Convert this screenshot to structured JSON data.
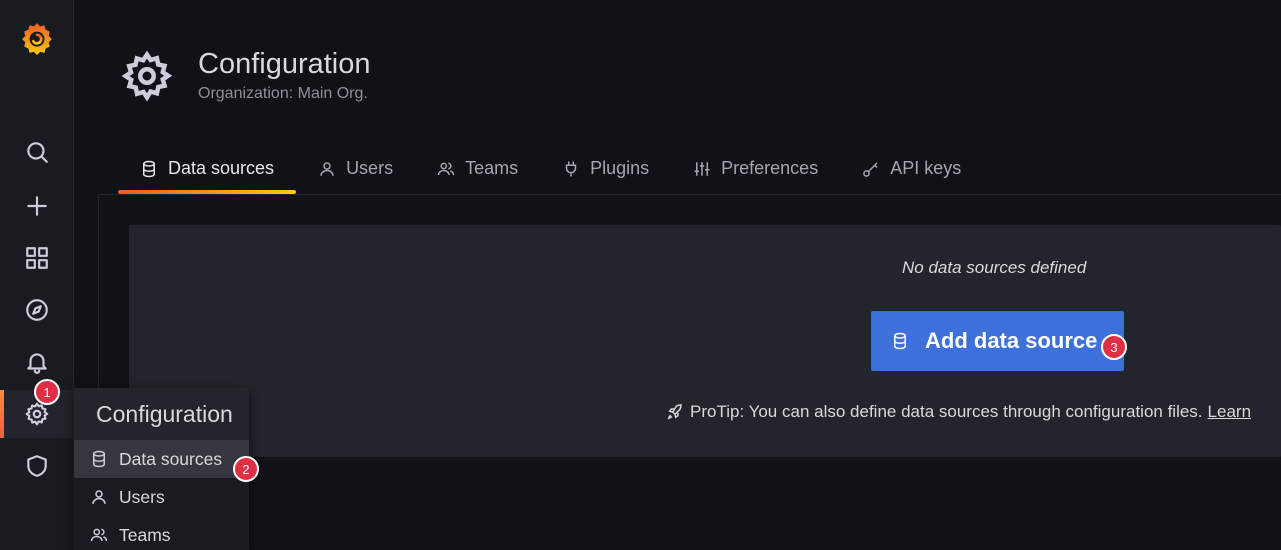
{
  "sidebar": {
    "logo": "grafana-logo",
    "items": [
      {
        "name": "search",
        "icon": "search-icon"
      },
      {
        "name": "create",
        "icon": "plus-icon"
      },
      {
        "name": "dashboards",
        "icon": "apps-icon"
      },
      {
        "name": "explore",
        "icon": "compass-icon"
      },
      {
        "name": "alerting",
        "icon": "bell-icon"
      },
      {
        "name": "configuration",
        "icon": "cog-icon",
        "active": true
      },
      {
        "name": "server-admin",
        "icon": "shield-icon"
      }
    ]
  },
  "header": {
    "title": "Configuration",
    "subtitle": "Organization: Main Org."
  },
  "tabs": [
    {
      "label": "Data sources",
      "icon": "database-icon",
      "active": true
    },
    {
      "label": "Users",
      "icon": "user-icon"
    },
    {
      "label": "Teams",
      "icon": "users-icon"
    },
    {
      "label": "Plugins",
      "icon": "plug-icon"
    },
    {
      "label": "Preferences",
      "icon": "sliders-icon"
    },
    {
      "label": "API keys",
      "icon": "key-icon"
    }
  ],
  "main": {
    "empty_text": "No data sources defined",
    "add_button": "Add data source",
    "protip_text": "ProTip: You can also define data sources through configuration files.",
    "protip_link": "Learn"
  },
  "flyout": {
    "title": "Configuration",
    "items": [
      {
        "label": "Data sources",
        "icon": "database-icon",
        "active": true
      },
      {
        "label": "Users",
        "icon": "user-icon"
      },
      {
        "label": "Teams",
        "icon": "users-icon"
      }
    ]
  },
  "badges": {
    "b1": "1",
    "b2": "2",
    "b3": "3"
  },
  "colors": {
    "accent": "#3d71d9",
    "badge": "#e02f44",
    "active_bar": "#f55f3e"
  }
}
